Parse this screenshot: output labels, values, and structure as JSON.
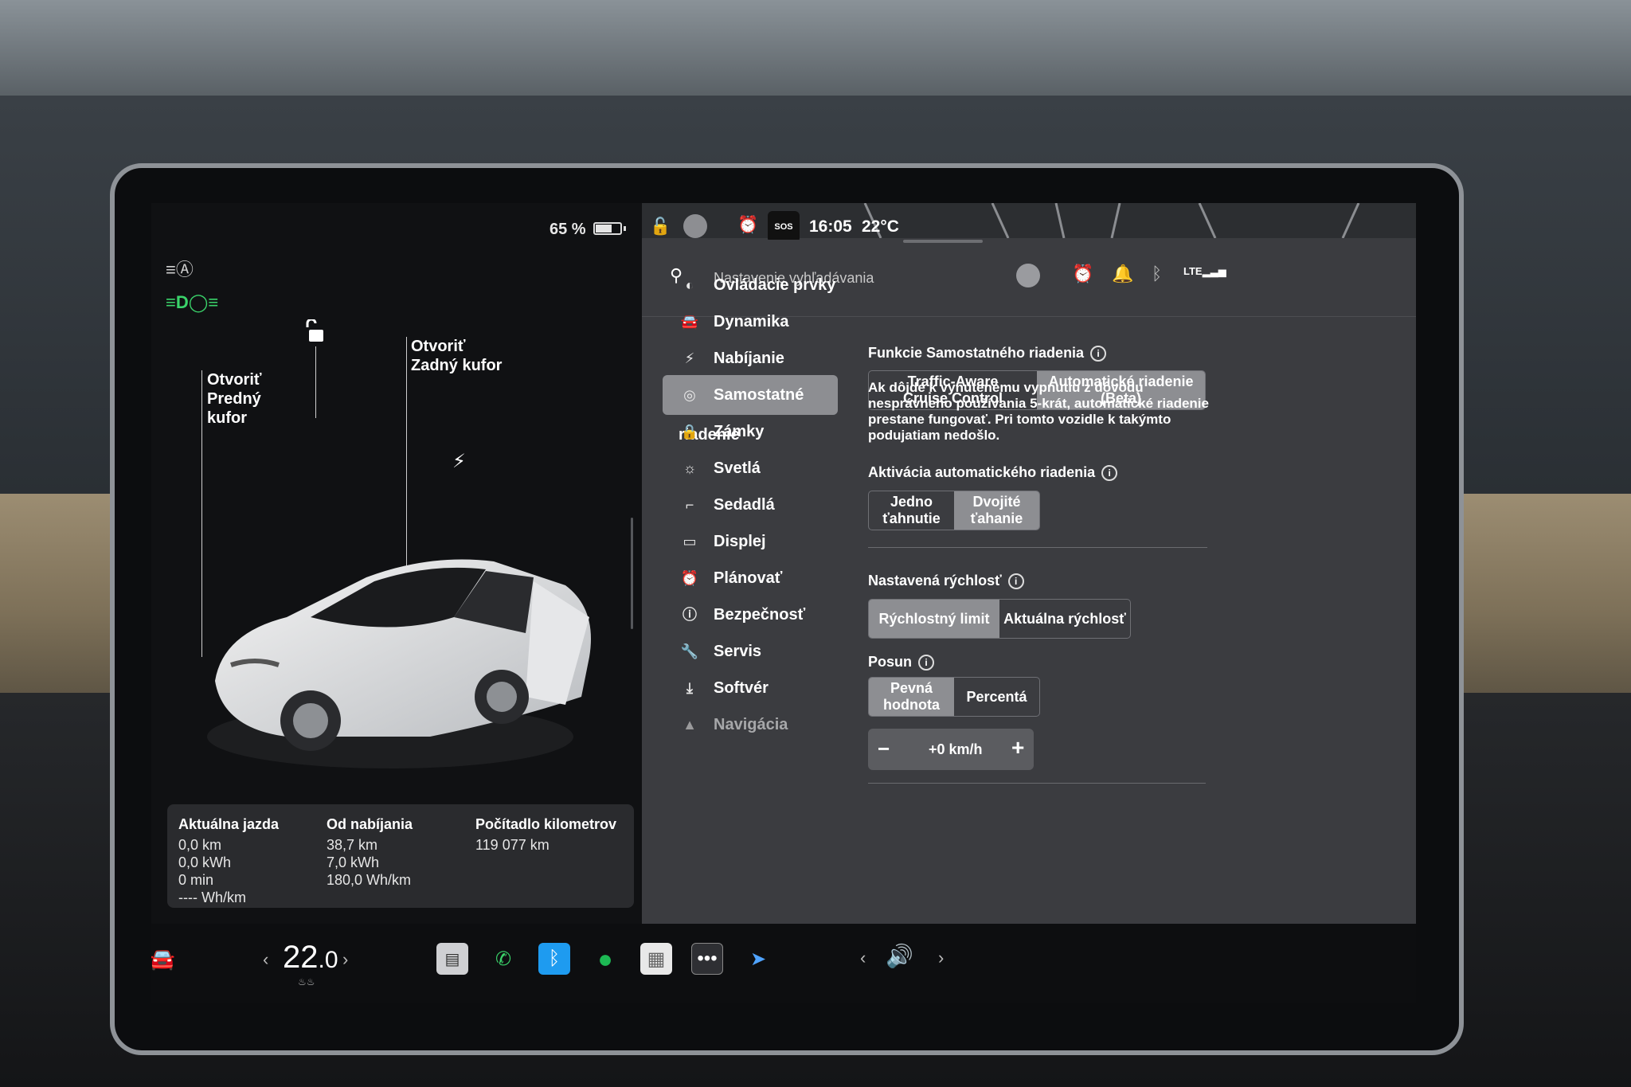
{
  "status": {
    "battery_percent": "65 %",
    "battery_level": 0.65,
    "time": "16:05",
    "temperature": "22°C",
    "sos_label": "SOS"
  },
  "car_panel": {
    "frunk_label": [
      "Otvoriť",
      "Predný",
      "kufor"
    ],
    "trunk_label": [
      "Otvoriť",
      "Zadný kufor"
    ]
  },
  "stats": {
    "current_trip": {
      "title": "Aktuálna jazda",
      "lines": [
        "0,0 km",
        "0,0 kWh",
        "0 min",
        "---- Wh/km"
      ]
    },
    "since_charge": {
      "title": "Od nabíjania",
      "lines": [
        "38,7 km",
        "7,0 kWh",
        "180,0 Wh/km"
      ]
    },
    "odometer": {
      "title": "Počítadlo kilometrov",
      "lines": [
        "119 077 km"
      ]
    }
  },
  "search": {
    "placeholder": "Nastavenie vyhľadávania"
  },
  "menu": [
    {
      "label": "Ovládacie prvky",
      "icon": "toggle-icon"
    },
    {
      "label": "Dynamika",
      "icon": "car-icon"
    },
    {
      "label": "Nabíjanie",
      "icon": "bolt-icon"
    },
    {
      "label": "Samostatné riadenie",
      "icon": "steering-wheel-icon",
      "active": true
    },
    {
      "label": "Zámky",
      "icon": "lock-icon"
    },
    {
      "label": "Svetlá",
      "icon": "sun-icon"
    },
    {
      "label": "Sedadlá",
      "icon": "seat-icon"
    },
    {
      "label": "Displej",
      "icon": "display-icon"
    },
    {
      "label": "Plánovať",
      "icon": "clock-icon"
    },
    {
      "label": "Bezpečnosť",
      "icon": "alert-icon"
    },
    {
      "label": "Servis",
      "icon": "wrench-icon"
    },
    {
      "label": "Softvér",
      "icon": "download-icon"
    },
    {
      "label": "Navigácia",
      "icon": "navigation-icon"
    }
  ],
  "autopilot": {
    "features_title": "Funkcie Samostatného riadenia",
    "features_options": [
      "Traffic-Aware\nCruise Control",
      "Automatické riadenie\n(Beta)"
    ],
    "features_selected": 1,
    "warning": "Ak dôjde k vynútenému vypnutiu z dôvodu nesprávneho používania 5-krát, automatické riadenie prestane fungovať. Pri tomto vozidle k takýmto podujatiam nedošlo.",
    "activation_title": "Aktivácia automatického riadenia",
    "activation_options": [
      "Jedno ťahnutie",
      "Dvojité ťahanie"
    ],
    "activation_selected": 1,
    "speed_title": "Nastavená rýchlosť",
    "speed_options": [
      "Rýchlostný limit",
      "Aktuálna rýchlosť"
    ],
    "speed_selected": 0,
    "offset_title": "Posun",
    "offset_options": [
      "Pevná hodnota",
      "Percentá"
    ],
    "offset_selected": 0,
    "offset_value": "+0 km/h",
    "minus_label": "−",
    "plus_label": "+"
  },
  "dock": {
    "temperature_value": "22",
    "temperature_decimal": ".0"
  },
  "colors": {
    "accent_green": "#3ad36a",
    "alarm_yellow": "#f2c230",
    "spotify_green": "#1db954",
    "bluetooth_blue": "#1e9bf0"
  }
}
